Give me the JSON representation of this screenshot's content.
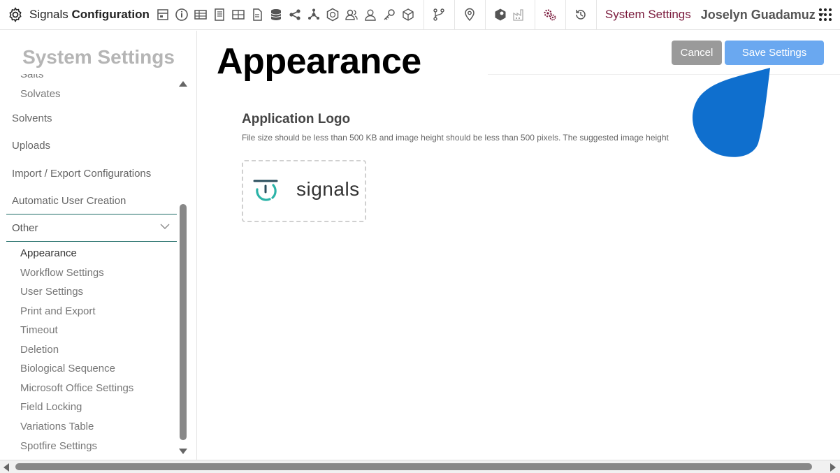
{
  "header": {
    "brand_light": "Signals",
    "brand_bold": "Configuration",
    "system_settings_link": "System Settings",
    "user_name": "Joselyn Guadamuz"
  },
  "sidebar": {
    "title": "System Settings",
    "items_top": [
      {
        "label": "Salts",
        "sub": true
      },
      {
        "label": "Solvates",
        "sub": true
      },
      {
        "label": "Solvents",
        "sub": false
      },
      {
        "label": "Uploads",
        "sub": false
      },
      {
        "label": "Import / Export Configurations",
        "sub": false
      },
      {
        "label": "Automatic User Creation",
        "sub": false
      }
    ],
    "group_label": "Other",
    "sub_items": [
      "Appearance",
      "Workflow Settings",
      "User Settings",
      "Print and Export",
      "Timeout",
      "Deletion",
      "Biological Sequence",
      "Microsoft Office Settings",
      "Field Locking",
      "Variations Table",
      "Spotfire Settings"
    ],
    "active_item": "Appearance"
  },
  "main": {
    "title": "Appearance",
    "cancel_label": "Cancel",
    "save_label": "Save Settings",
    "section_title": "Application Logo",
    "section_desc": "File size should be less than 500 KB and image height should be less than 500 pixels. The suggested image height",
    "logo_text": "signals"
  },
  "colors": {
    "accent_link": "#7a1a3c",
    "save_button": "#6aa8f0",
    "cancel_button": "#9a9a9a",
    "active_border": "#1e6b66",
    "drop_marker": "#0f6fce",
    "logo_teal": "#2bb3a8"
  }
}
